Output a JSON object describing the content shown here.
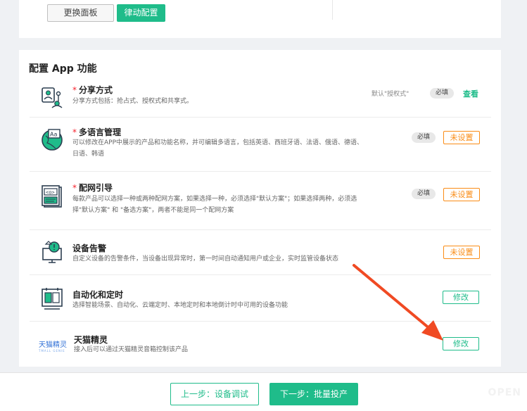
{
  "top": {
    "change_panel_label": "更换面板",
    "rhythm_config_label": "律动配置"
  },
  "section": {
    "title": "配置 App 功能"
  },
  "features": [
    {
      "title": "分享方式",
      "required_mark": "*",
      "desc": "分享方式包括：抢占式、授权式和共享式。",
      "hint": "默认\"授权式\"",
      "tag": "必填",
      "action": "查看",
      "icon": "share-person-icon"
    },
    {
      "title": "多语言管理",
      "required_mark": "*",
      "desc": "可以修改在APP中展示的产品和功能名称，并可编辑多语言，包括英语、西班牙语、法语、俄语、德语、日语、韩语",
      "tag": "必填",
      "action": "未设置",
      "icon": "language-globe-icon"
    },
    {
      "title": "配网引导",
      "required_mark": "*",
      "desc": "每款产品可以选择一种或两种配网方案，如果选择一种，必须选择\"默认方案\"；如果选择两种，必须选择\"默认方案\" 和 \"备选方案\"，两者不能是同一个配网方案",
      "tag": "必填",
      "action": "未设置",
      "icon": "network-guide-icon"
    },
    {
      "title": "设备告警",
      "desc": "自定义设备的告警条件，当设备出现异常时，第一时间自动通知用户或企业，实时监管设备状态",
      "action": "未设置",
      "icon": "alarm-monitor-icon"
    },
    {
      "title": "自动化和定时",
      "desc": "选择智能场景、自动化、云端定时、本地定时和本地倒计时中可用的设备功能",
      "action": "修改",
      "icon": "automation-calendar-icon"
    },
    {
      "title": "天猫精灵",
      "desc": "接入后可以通过天猫精灵音箱控制该产品",
      "action": "修改",
      "logo_cn": "天猫精灵",
      "logo_en": "TMALL GENIE",
      "icon": "tmall-genie-logo"
    }
  ],
  "footer": {
    "prev_label": "上一步：设备调试",
    "next_label": "下一步：批量投产",
    "watermark": "OPEN"
  },
  "colors": {
    "accent_green": "#1fbc8a",
    "warning_orange": "#fa8c16",
    "required_red": "#f5222d",
    "annotation_arrow": "#f04a23"
  }
}
